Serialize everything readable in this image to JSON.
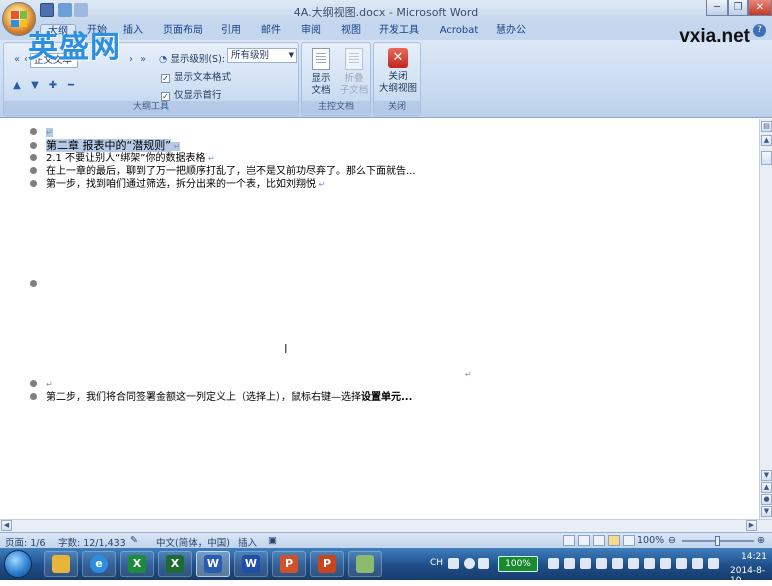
{
  "window": {
    "title": "4A.大纲视图.docx - Microsoft Word",
    "controls": [
      "─",
      "❐",
      "✕"
    ]
  },
  "tabs": [
    "大纲",
    "开始",
    "插入",
    "页面布局",
    "引用",
    "邮件",
    "审阅",
    "视图",
    "开发工具",
    "Acrobat",
    "慧办公"
  ],
  "help_icon": "?",
  "ribbon": {
    "outline_tools": {
      "level_box": "正文文本",
      "show_level_label": "显示级别(S):",
      "show_level_value": "所有级别",
      "show_text_format": "显示文本格式",
      "first_line_only": "仅显示首行",
      "group_label": "大纲工具"
    },
    "master_doc": {
      "show_doc": "显示\n文档",
      "collapse_subdocs": "折叠\n子文档",
      "group_label": "主控文档"
    },
    "close": {
      "close_outline": "关闭\n大纲视图",
      "group_label": "关闭"
    }
  },
  "watermarks": {
    "logo": "英盛网",
    "site": "vxia.net"
  },
  "document": {
    "lines": [
      "↵",
      "第二章  报表中的“潜规则”",
      "2.1 不要让别人“绑架”你的数据表格",
      "在上一章的最后，聊到了万一把顺序打乱了，岂不是又前功尽弃了。那么下面就告...",
      "第一步，找到咱们通过筛选，拆分出来的一个表，比如刘翔悦",
      "",
      "↵",
      "第二步，我们将合同签署金额这一列定义上（选择上），鼠标右键—选择",
      "设置单元..."
    ]
  },
  "status": {
    "page": "页面: 1/6",
    "words": "字数: 12/1,433",
    "language": "中文(简体，中国)",
    "mode": "插入",
    "zoom": "100%"
  },
  "taskbar": {
    "apps": [
      "folder",
      "ie",
      "excel",
      "excel2",
      "word",
      "word2",
      "ppt",
      "ppt2",
      "green"
    ],
    "ime": "CH",
    "battery": "100%",
    "time": "14:21",
    "date": "2014-8-10"
  }
}
